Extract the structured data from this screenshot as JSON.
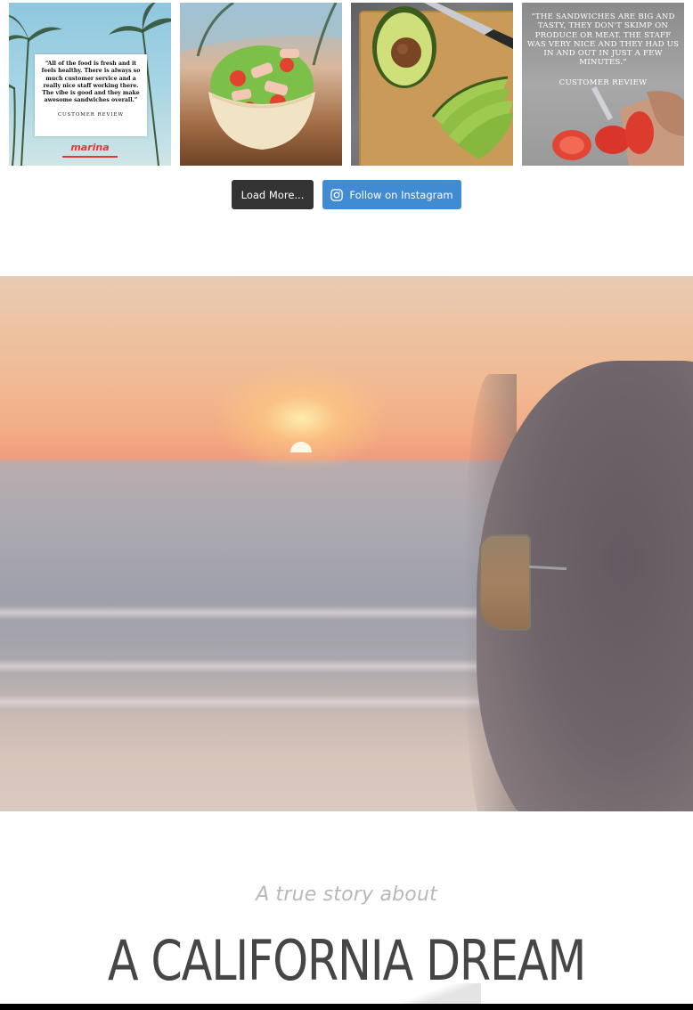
{
  "instagram_feed": {
    "posts": [
      {
        "type": "quote-card",
        "quote": "“All of the food is fresh and it feels healthy. There is always so much customer service and a really nice staff working there. The vibe is good and they make awesome sandwiches overall.”",
        "caption": "CUSTOMER REVIEW",
        "logo_text": "marina"
      },
      {
        "type": "photo",
        "subject": "salad-bowl"
      },
      {
        "type": "photo",
        "subject": "avocado-cutting-board"
      },
      {
        "type": "quote-photo",
        "quote": "“THE SANDWICHES ARE BIG AND TASTY, THEY DON'T SKIMP ON PRODUCE OR MEAT. THE STAFF WAS VERY NICE AND THEY HAD US IN AND OUT IN JUST A FEW MINUTES.”",
        "caption": "CUSTOMER REVIEW"
      }
    ],
    "load_more_label": "Load More...",
    "follow_label": "Follow on Instagram",
    "follow_icon": "instagram-icon",
    "colors": {
      "load_more_bg": "#333333",
      "follow_bg": "#408bd1"
    }
  },
  "hero": {
    "image_subject": "sunset-beach-woman-sunglasses"
  },
  "story": {
    "subtitle": "A true story about",
    "title": "A CALIFORNIA DREAM"
  }
}
